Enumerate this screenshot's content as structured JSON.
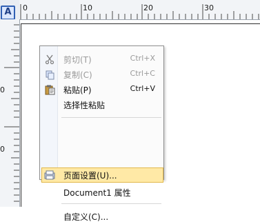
{
  "ruler": {
    "corner_letter": "A",
    "h_labels": [
      "0",
      "10",
      "20",
      "30"
    ],
    "v_labels": [
      "0",
      "0"
    ]
  },
  "context_menu": {
    "items": [
      {
        "label": "剪切(T)",
        "shortcut": "Ctrl+X",
        "enabled": false,
        "icon": "scissors-icon"
      },
      {
        "label": "复制(C)",
        "shortcut": "Ctrl+C",
        "enabled": false,
        "icon": "copy-icon"
      },
      {
        "label": "粘贴(P)",
        "shortcut": "Ctrl+V",
        "enabled": true,
        "icon": "paste-icon"
      },
      {
        "label": "选择性粘贴",
        "shortcut": "",
        "enabled": true,
        "icon": ""
      },
      {
        "label": "页面设置(U)...",
        "shortcut": "",
        "enabled": true,
        "icon": "page-setup-icon",
        "highlighted": true
      },
      {
        "label": "Document1 属性",
        "shortcut": "",
        "enabled": true,
        "icon": ""
      },
      {
        "label": "自定义(C)...",
        "shortcut": "",
        "enabled": true,
        "icon": ""
      }
    ]
  }
}
